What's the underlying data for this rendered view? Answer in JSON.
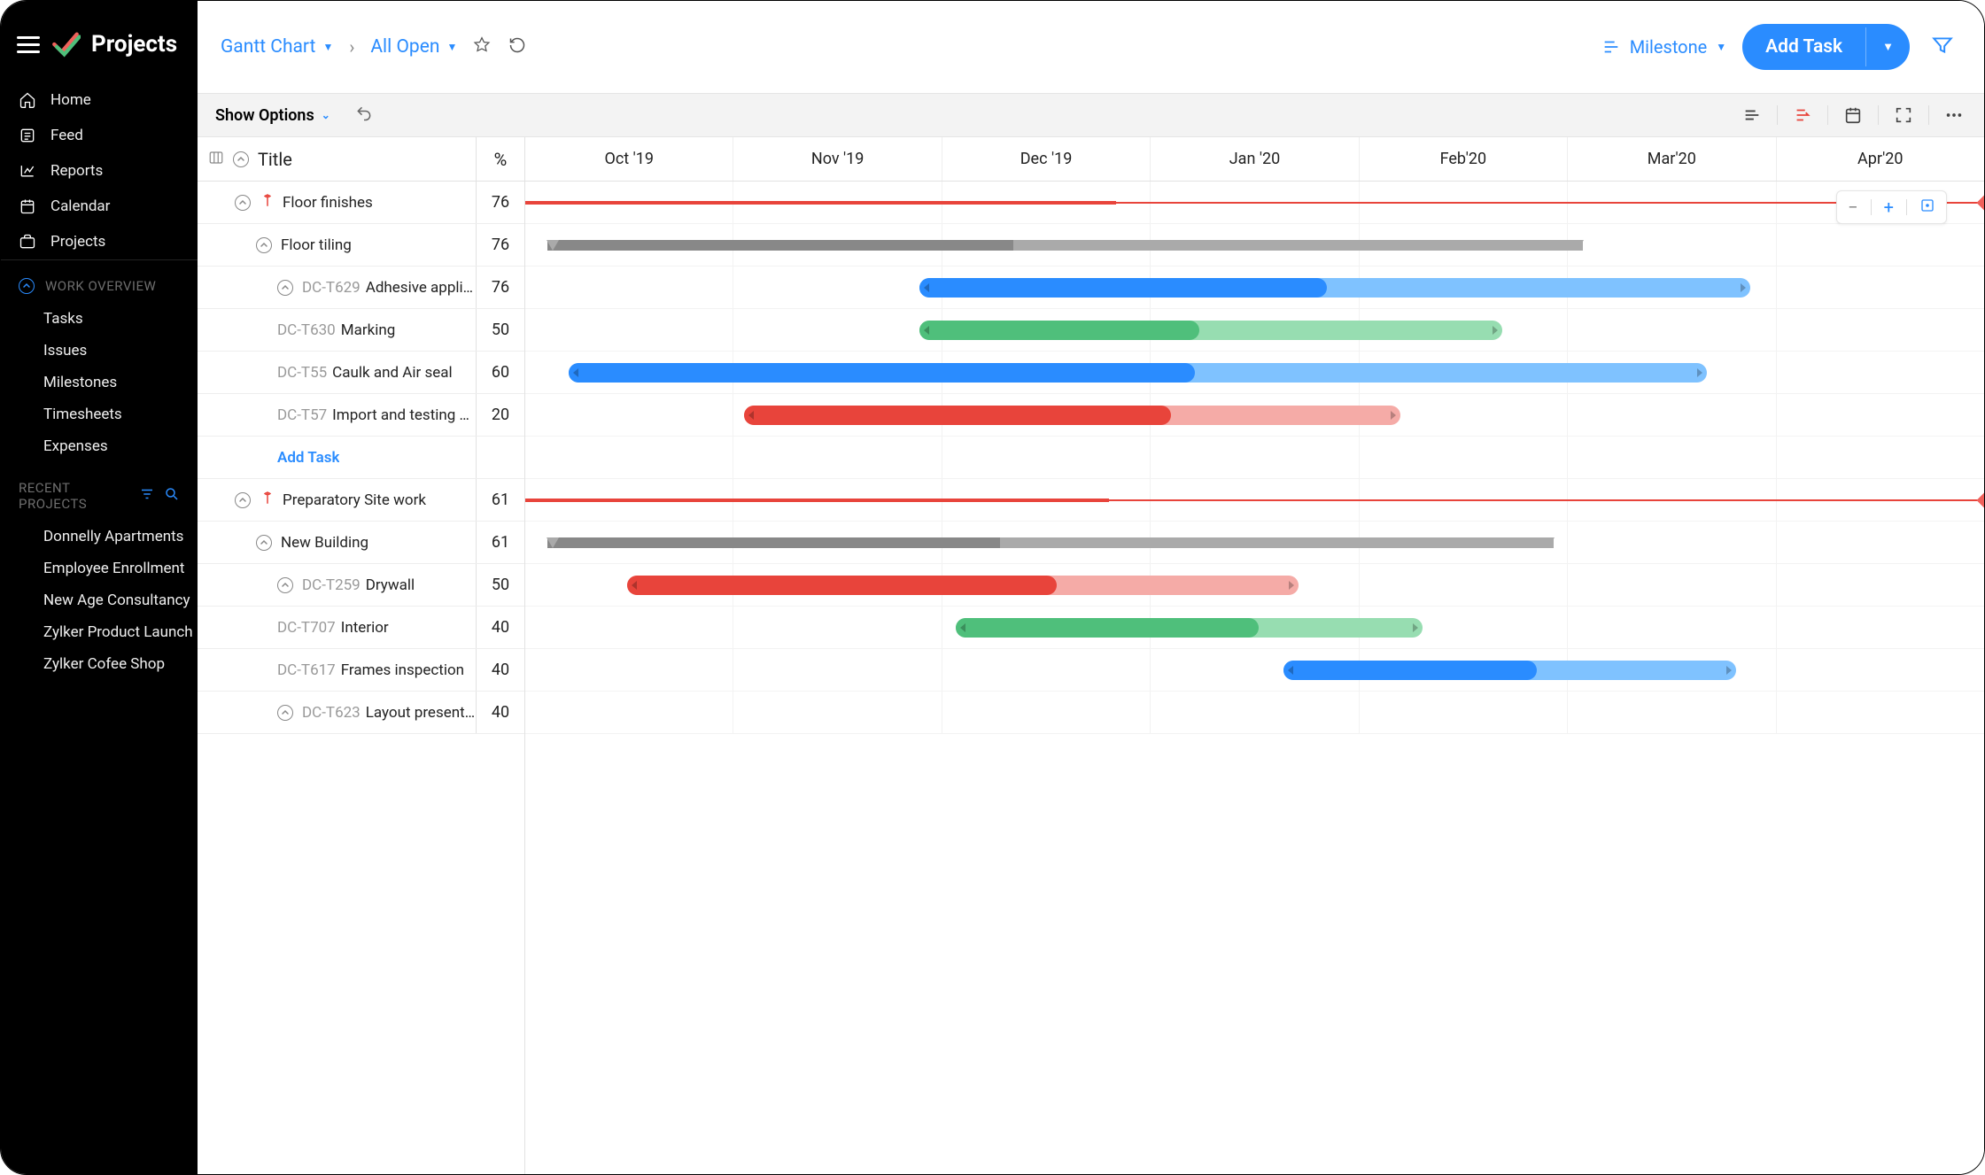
{
  "brand": {
    "name": "Projects"
  },
  "sidebar": {
    "nav": [
      {
        "label": "Home",
        "icon": "home"
      },
      {
        "label": "Feed",
        "icon": "feed"
      },
      {
        "label": "Reports",
        "icon": "reports"
      },
      {
        "label": "Calendar",
        "icon": "calendar"
      },
      {
        "label": "Projects",
        "icon": "projects"
      }
    ],
    "work_overview_label": "WORK OVERVIEW",
    "work_overview": [
      {
        "label": "Tasks"
      },
      {
        "label": "Issues"
      },
      {
        "label": "Milestones"
      },
      {
        "label": "Timesheets"
      },
      {
        "label": "Expenses"
      }
    ],
    "recent_label": "RECENT PROJECTS",
    "recent": [
      {
        "label": "Donnelly Apartments"
      },
      {
        "label": "Employee Enrollment"
      },
      {
        "label": "New Age Consultancy"
      },
      {
        "label": "Zylker Product Launch"
      },
      {
        "label": "Zylker Cofee Shop"
      }
    ]
  },
  "topbar": {
    "crumb1": "Gantt Chart",
    "crumb2": "All Open",
    "grouping": "Milestone",
    "add_task": "Add Task"
  },
  "options_bar": {
    "show_options": "Show Options"
  },
  "gantt": {
    "title_header": "Title",
    "pct_header": "%",
    "months": [
      "Oct '19",
      "Nov '19",
      "Dec '19",
      "Jan '20",
      "Feb'20",
      "Mar'20",
      "Apr'20"
    ],
    "add_task_label": "Add Task",
    "rows": [
      {
        "type": "milestone",
        "indent": 1,
        "label": "Floor finishes",
        "pct": "76",
        "start": 0,
        "len": 100,
        "done_pct": 40.5
      },
      {
        "type": "summary",
        "indent": 2,
        "label": "Floor tiling",
        "pct": "76",
        "start": 1.5,
        "len": 71,
        "fill": 45
      },
      {
        "type": "task",
        "indent": 3,
        "code": "DC-T629",
        "label": "Adhesive application",
        "pct": "76",
        "start": 27,
        "len": 57,
        "color": "#2A8CFF",
        "light": "#7FC2FF",
        "prog": 49
      },
      {
        "type": "task",
        "indent": 3,
        "code": "DC-T630",
        "label": "Marking",
        "pct": "50",
        "start": 27,
        "len": 40,
        "color": "#4FBF7B",
        "light": "#97DDB1",
        "prog": 48
      },
      {
        "type": "task",
        "indent": 3,
        "code": "DC-T55",
        "label": "Caulk and Air seal",
        "pct": "60",
        "start": 3,
        "len": 78,
        "color": "#2A8CFF",
        "light": "#7FC2FF",
        "prog": 55
      },
      {
        "type": "task",
        "indent": 3,
        "code": "DC-T57",
        "label": "Import and testing of woo..",
        "pct": "20",
        "start": 15,
        "len": 45,
        "color": "#E8443B",
        "light": "#F5ABA7",
        "prog": 65
      },
      {
        "type": "addtask",
        "indent": 3
      },
      {
        "type": "milestone",
        "indent": 1,
        "label": "Preparatory Site work",
        "pct": "61",
        "start": 0,
        "len": 100,
        "done_pct": 40
      },
      {
        "type": "summary",
        "indent": 2,
        "label": "New Building",
        "pct": "61",
        "start": 1.5,
        "len": 69,
        "fill": 45
      },
      {
        "type": "task",
        "indent": 3,
        "code": "DC-T259",
        "label": "Drywall",
        "pct": "50",
        "start": 7,
        "len": 46,
        "color": "#E8443B",
        "light": "#F5ABA7",
        "prog": 64
      },
      {
        "type": "task",
        "indent": 3,
        "code": "DC-T707",
        "label": "Interior",
        "pct": "40",
        "start": 29.5,
        "len": 32,
        "color": "#4FBF7B",
        "light": "#97DDB1",
        "prog": 65
      },
      {
        "type": "task",
        "indent": 3,
        "code": "DC-T617",
        "label": "Frames inspection",
        "pct": "40",
        "start": 52,
        "len": 31,
        "color": "#2A8CFF",
        "light": "#7FC2FF",
        "prog": 56
      },
      {
        "type": "task",
        "indent": 3,
        "code": "DC-T623",
        "label": "Layout presentation",
        "pct": "40",
        "start": 0,
        "len": 0,
        "color": "#2A8CFF",
        "light": "#7FC2FF",
        "prog": 0,
        "hidden": true
      }
    ]
  }
}
